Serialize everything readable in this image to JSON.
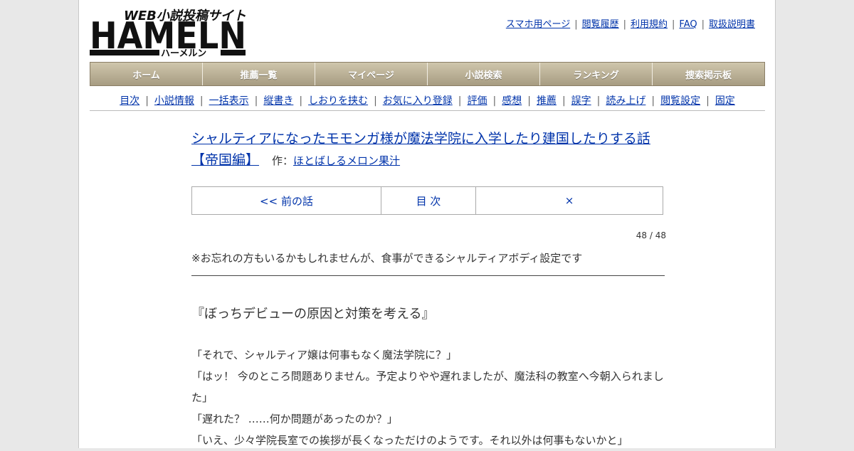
{
  "logo": {
    "tagline": "WEB小説投稿サイト",
    "wordmark": "HAMELN",
    "kana": "ハーメルン"
  },
  "header_links": [
    "スマホ用ページ",
    "閲覧履歴",
    "利用規約",
    "FAQ",
    "取扱説明書"
  ],
  "global_nav": [
    "ホーム",
    "推薦一覧",
    "マイページ",
    "小説検索",
    "ランキング",
    "捜索掲示板"
  ],
  "novel_nav": [
    "目次",
    "小説情報",
    "一括表示",
    "縦書き",
    "しおりを挟む",
    "お気に入り登録",
    "評価",
    "感想",
    "推薦",
    "誤字",
    "読み上げ",
    "閲覧設定",
    "固定"
  ],
  "novel": {
    "title": "シャルティアになったモモンガ様が魔法学院に入学したり建国したりする話【帝国編】",
    "author_prefix": "作：",
    "author": "ほとばしるメロン果汁"
  },
  "story_nav": {
    "prev": "<< 前の話",
    "toc": "目 次",
    "next": "×"
  },
  "page_count": "48 / 48",
  "preface": "※お忘れの方もいるかもしれませんが、食事ができるシャルティアボディ設定です",
  "chapter_title": "『ぼっちデビューの原因と対策を考える』",
  "body_lines": [
    "「それで、シャルティア嬢は何事もなく魔法学院に？」",
    "「はッ！ 今のところ問題ありません。予定よりやや遅れましたが、魔法科の教室へ今朝入られました」",
    "「遅れた？ ……何か問題があったのか？」",
    "「いえ、少々学院長室での挨拶が長くなっただけのようです。それ以外は何事もないかと」"
  ],
  "colors": {
    "link": "#0033aa",
    "nav_gradient_top": "#cfc6ac",
    "nav_gradient_bottom": "#a79c82"
  }
}
